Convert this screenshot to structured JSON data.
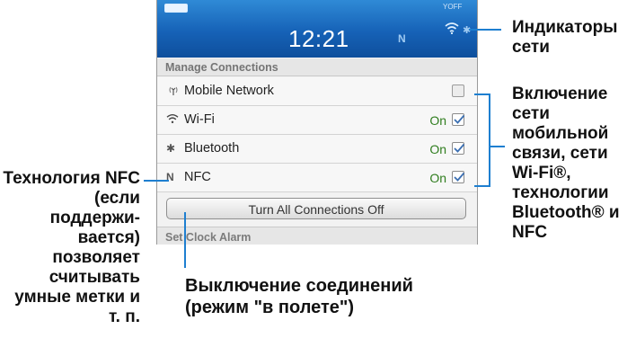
{
  "status_bar": {
    "time": "12:21",
    "signal_off_label": "OFF",
    "nfc_glyph": "N"
  },
  "connections": {
    "header": "Manage Connections",
    "items": [
      {
        "label": "Mobile Network",
        "state": "",
        "checked": false,
        "icon": "antenna-icon"
      },
      {
        "label": "Wi-Fi",
        "state": "On",
        "checked": true,
        "icon": "wifi-icon"
      },
      {
        "label": "Bluetooth",
        "state": "On",
        "checked": true,
        "icon": "bluetooth-icon"
      },
      {
        "label": "NFC",
        "state": "On",
        "checked": true,
        "icon": "nfc-icon"
      }
    ],
    "all_off_button": "Turn All Connections Off",
    "next_header": "Set Clock Alarm"
  },
  "callouts": {
    "network_indicators": "Индикаторы сети",
    "enable_networks": "Включение сети мобильной связи, сети Wi-Fi®, технологии Bluetooth® и NFC",
    "nfc_tech": "Технология NFC (если поддержи-вается) позволяет считывать умные метки и т. п.",
    "airplane_mode": "Выключение соединений (режим \"в полете\")"
  },
  "colors": {
    "status_bar": "#1662b7",
    "callout_line": "#1e7fd0",
    "on_text": "#2f7d1e"
  }
}
